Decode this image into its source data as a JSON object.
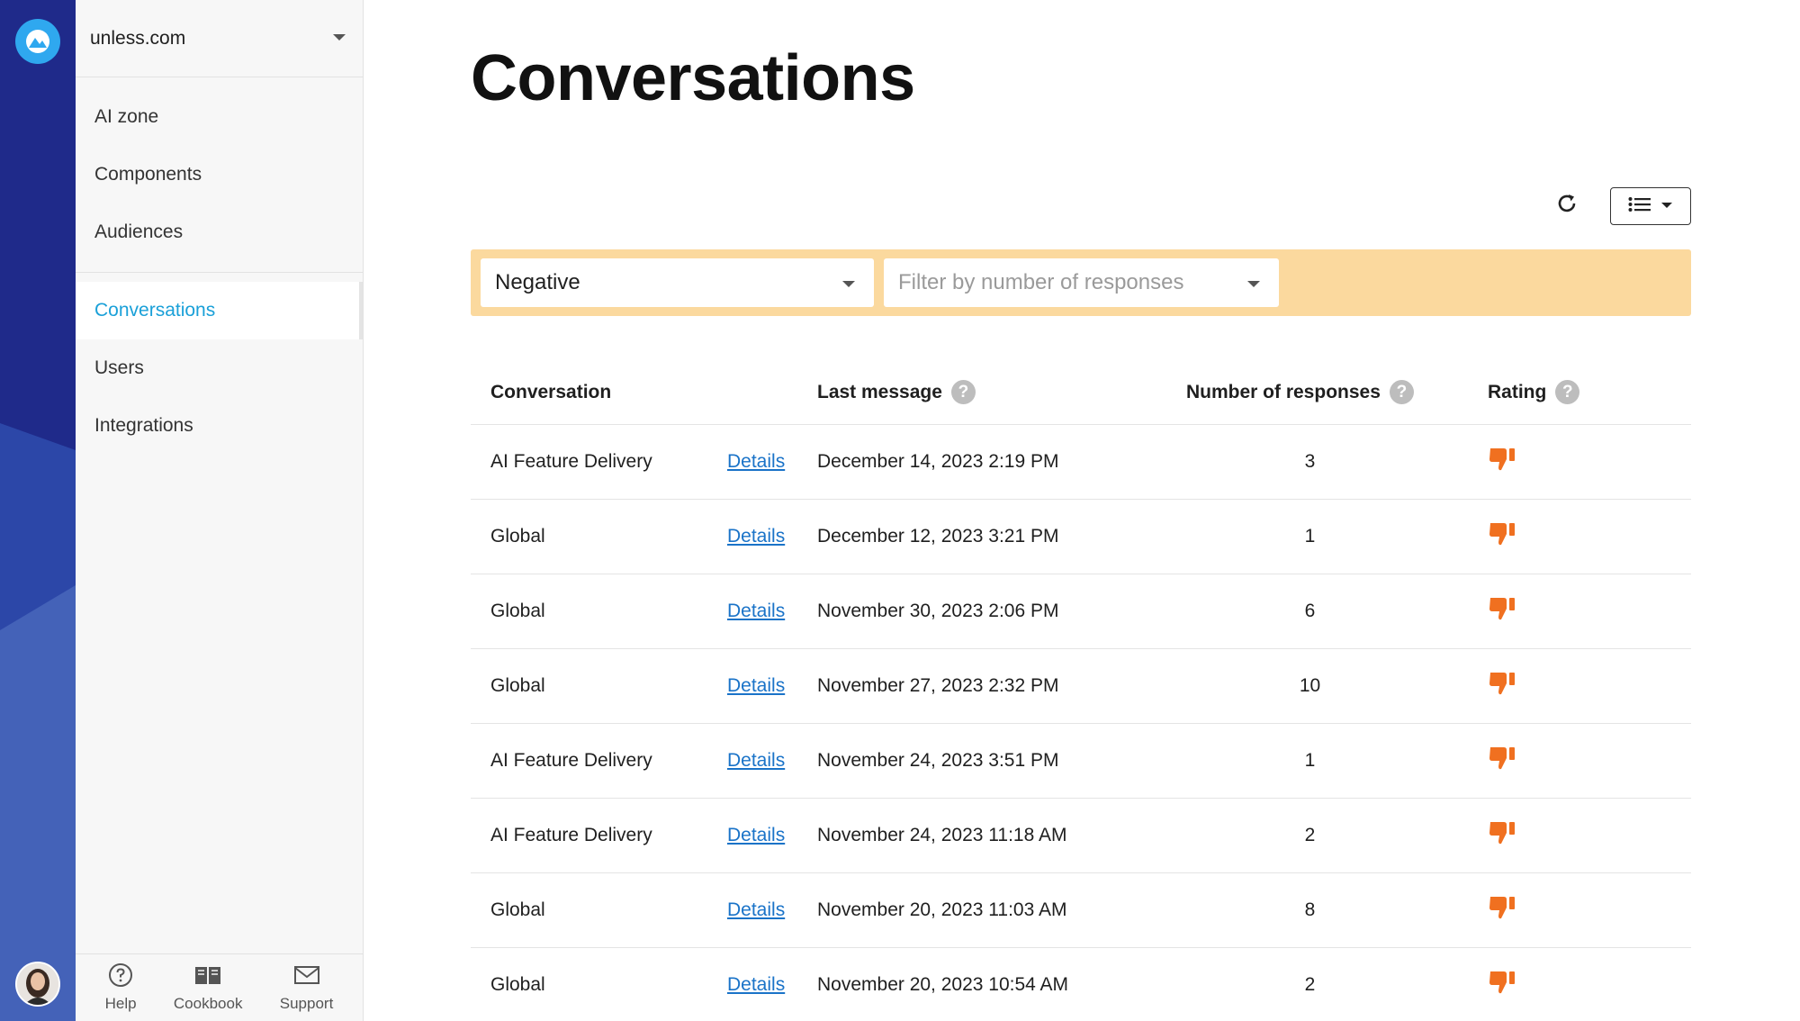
{
  "sidebar": {
    "workspace": "unless.com",
    "nav_primary": [
      {
        "label": "AI zone"
      },
      {
        "label": "Components"
      },
      {
        "label": "Audiences"
      }
    ],
    "nav_secondary": [
      {
        "label": "Conversations",
        "active": true
      },
      {
        "label": "Users"
      },
      {
        "label": "Integrations"
      }
    ],
    "footer": {
      "help": "Help",
      "cookbook": "Cookbook",
      "support": "Support"
    }
  },
  "main": {
    "title": "Conversations",
    "filters": {
      "rating_value": "Negative",
      "responses_placeholder": "Filter by number of responses"
    },
    "table": {
      "headers": {
        "conversation": "Conversation",
        "last_message": "Last message",
        "responses": "Number of responses",
        "rating": "Rating"
      },
      "rows": [
        {
          "conversation": "AI Feature Delivery",
          "details": "Details",
          "last_message": "December 14, 2023 2:19 PM",
          "responses": "3",
          "rating": "negative"
        },
        {
          "conversation": "Global",
          "details": "Details",
          "last_message": "December 12, 2023 3:21 PM",
          "responses": "1",
          "rating": "negative"
        },
        {
          "conversation": "Global",
          "details": "Details",
          "last_message": "November 30, 2023 2:06 PM",
          "responses": "6",
          "rating": "negative"
        },
        {
          "conversation": "Global",
          "details": "Details",
          "last_message": "November 27, 2023 2:32 PM",
          "responses": "10",
          "rating": "negative"
        },
        {
          "conversation": "AI Feature Delivery",
          "details": "Details",
          "last_message": "November 24, 2023 3:51 PM",
          "responses": "1",
          "rating": "negative"
        },
        {
          "conversation": "AI Feature Delivery",
          "details": "Details",
          "last_message": "November 24, 2023 11:18 AM",
          "responses": "2",
          "rating": "negative"
        },
        {
          "conversation": "Global",
          "details": "Details",
          "last_message": "November 20, 2023 11:03 AM",
          "responses": "8",
          "rating": "negative"
        },
        {
          "conversation": "Global",
          "details": "Details",
          "last_message": "November 20, 2023 10:54 AM",
          "responses": "2",
          "rating": "negative"
        }
      ]
    }
  },
  "colors": {
    "rail": "#1f2a8a",
    "accent": "#1aa0d8",
    "filter_bar": "#fbd99e",
    "thumbs_down": "#f07020",
    "link": "#1a73c8"
  },
  "icons": {
    "rail_logo": "unless-logo-icon",
    "refresh": "refresh-icon",
    "view": "list-view-icon",
    "dropdown": "caret-down-icon",
    "help": "question-circle-icon",
    "cookbook": "book-icon",
    "support": "mail-icon",
    "rating": "thumbs-down-icon"
  }
}
